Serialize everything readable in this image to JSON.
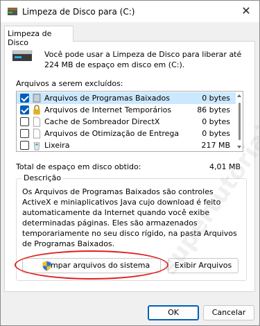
{
  "window": {
    "title": "Limpeza de Disco para  (C:)",
    "close_glyph": "✕"
  },
  "tab": {
    "label": "Limpeza de Disco"
  },
  "intro_text": "Você pode usar a Limpeza de Disco para liberar até 224 MB de espaço em disco em  (C:).",
  "list": {
    "label": "Arquivos a serem excluídos:",
    "items": [
      {
        "name": "Arquivos de Programas Baixados",
        "size": "0 bytes",
        "checked": true,
        "selected": true,
        "icon": "folder-icon"
      },
      {
        "name": "Arquivos de Internet Temporários",
        "size": "86 bytes",
        "checked": true,
        "selected": false,
        "icon": "lock-icon"
      },
      {
        "name": "Cache de Sombreador DirectX",
        "size": "0 bytes",
        "checked": false,
        "selected": false,
        "icon": "document-icon"
      },
      {
        "name": "Arquivos de Otimização de Entrega",
        "size": "0 bytes",
        "checked": false,
        "selected": false,
        "icon": "document-icon"
      },
      {
        "name": "Lixeira",
        "size": "217 MB",
        "checked": false,
        "selected": false,
        "icon": "recycle-bin-icon"
      }
    ]
  },
  "total": {
    "label": "Total de espaço em disco obtido:",
    "value": "4,01 MB"
  },
  "description": {
    "legend": "Descrição",
    "text": "Os Arquivos de Programas Baixados são controles ActiveX e miniaplicativos Java cujo download é feito automaticamente da Internet quando você exibe determinadas páginas. Eles são armazenados temporariamente no seu disco rígido, na pasta Arquivos de Programas Baixados."
  },
  "buttons": {
    "clean_system": "Limpar arquivos do sistema",
    "view_files": "Exibir Arquivos",
    "ok": "OK",
    "cancel": "Cancelar"
  },
  "watermark": {
    "text": "supertutoriais.com.br"
  },
  "colors": {
    "accent": "#005fb8",
    "selection": "#cce8ff",
    "highlight": "#e02020"
  }
}
